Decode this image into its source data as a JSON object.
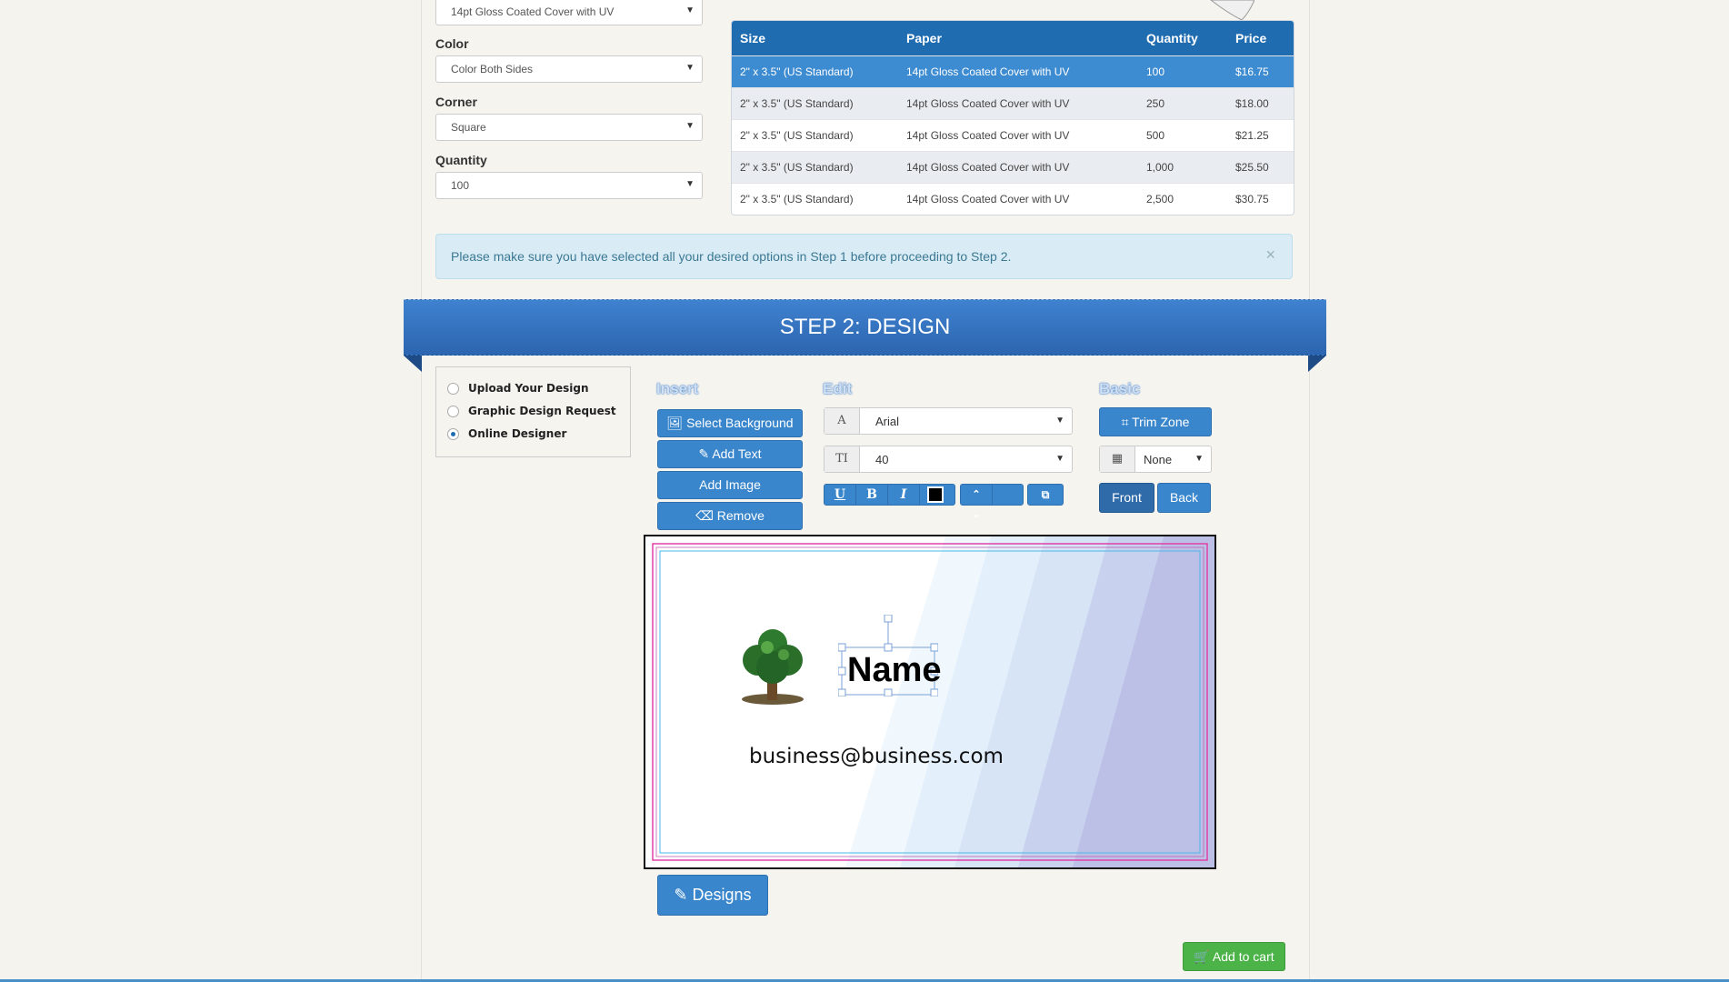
{
  "step1": {
    "paper_select": {
      "value": "14pt Gloss Coated Cover with UV"
    },
    "color": {
      "label": "Color",
      "value": "Color Both Sides"
    },
    "corner": {
      "label": "Corner",
      "value": "Square"
    },
    "quantity": {
      "label": "Quantity",
      "value": "100"
    }
  },
  "price_table": {
    "headers": [
      "Size",
      "Paper",
      "Quantity",
      "Price"
    ],
    "rows": [
      {
        "size": "2\" x 3.5\" (US Standard)",
        "paper": "14pt Gloss Coated Cover with UV",
        "qty": "100",
        "price": "$16.75"
      },
      {
        "size": "2\" x 3.5\" (US Standard)",
        "paper": "14pt Gloss Coated Cover with UV",
        "qty": "250",
        "price": "$18.00"
      },
      {
        "size": "2\" x 3.5\" (US Standard)",
        "paper": "14pt Gloss Coated Cover with UV",
        "qty": "500",
        "price": "$21.25"
      },
      {
        "size": "2\" x 3.5\" (US Standard)",
        "paper": "14pt Gloss Coated Cover with UV",
        "qty": "1,000",
        "price": "$25.50"
      },
      {
        "size": "2\" x 3.5\" (US Standard)",
        "paper": "14pt Gloss Coated Cover with UV",
        "qty": "2,500",
        "price": "$30.75"
      }
    ],
    "selected_index": 0
  },
  "alert": {
    "text": "Please make sure you have selected all your desired options in Step 1 before proceeding to Step 2.",
    "close": "×"
  },
  "step2": {
    "title": "STEP 2: DESIGN",
    "options": [
      "Upload Your Design",
      "Graphic Design Request",
      "Online Designer"
    ],
    "selected_option": "Online Designer"
  },
  "insert": {
    "title": "Insert",
    "select_background": "Select Background",
    "add_text": "Add Text",
    "add_image": "Add Image",
    "remove": "Remove"
  },
  "edit": {
    "title": "Edit",
    "font": "Arial",
    "font_size": "40",
    "underline": "U",
    "bold": "B",
    "italic": "I"
  },
  "basic": {
    "title": "Basic",
    "trim_zone": "Trim Zone",
    "grid_value": "None",
    "front": "Front",
    "back": "Back"
  },
  "card": {
    "name": "Name",
    "email": "business@business.com"
  },
  "designs_button": "Designs",
  "add_to_cart": "Add to cart",
  "colors": {
    "primary": "#3a86cc",
    "header_blue": "#1f6cb1",
    "success": "#4cb348",
    "alert_bg": "#d9ecf5"
  }
}
